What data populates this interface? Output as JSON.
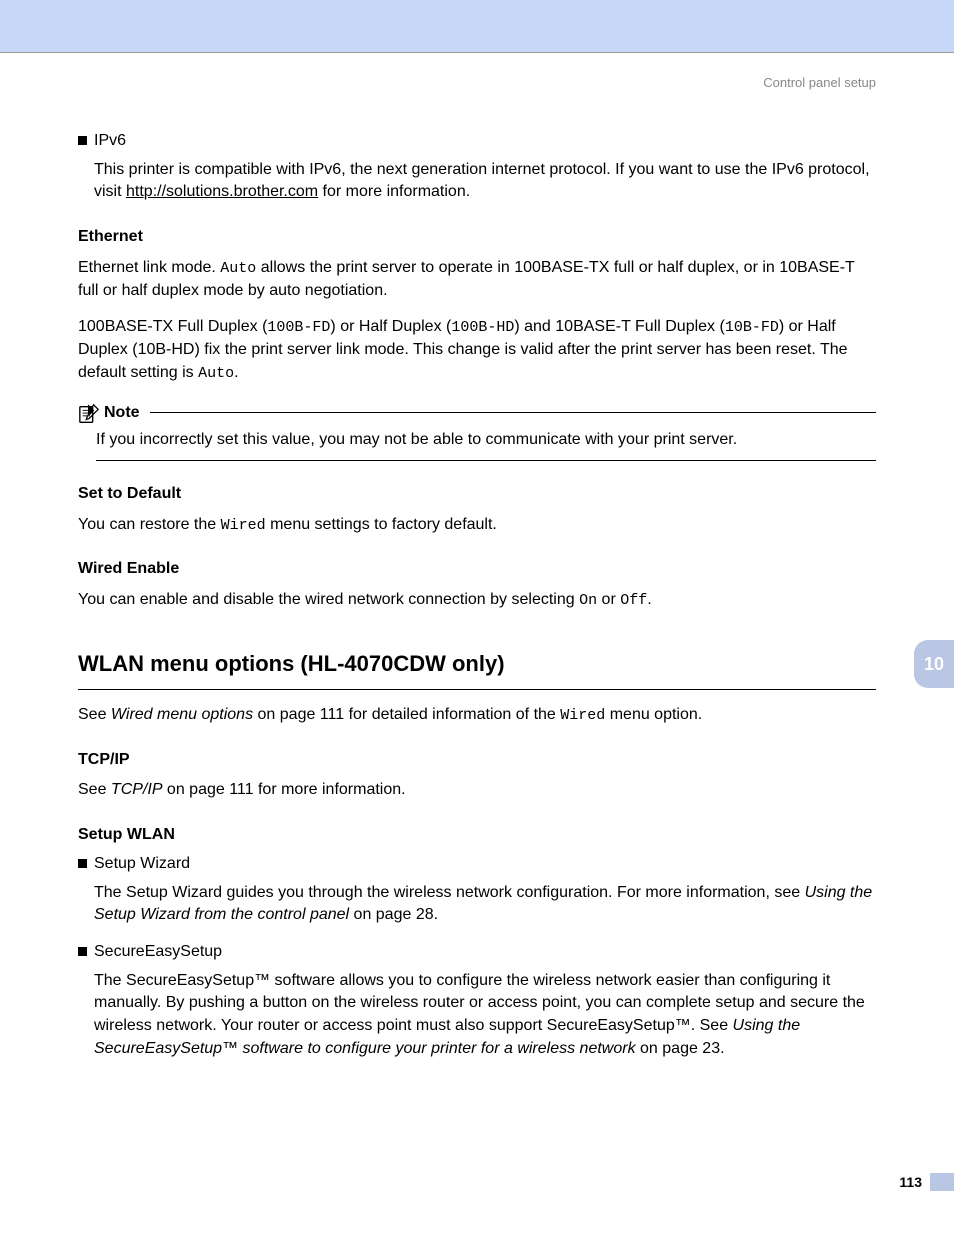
{
  "header": {
    "section_label": "Control panel setup"
  },
  "side_tab": {
    "chapter": "10"
  },
  "footer": {
    "page_number": "113"
  },
  "ipv6": {
    "bullet_label": "IPv6",
    "body_pre": "This printer is compatible with IPv6, the next generation internet protocol. If you want to use the IPv6 protocol, visit ",
    "link": "http://solutions.brother.com",
    "body_post": " for more information."
  },
  "ethernet": {
    "heading": "Ethernet",
    "p1_pre": "Ethernet link mode. ",
    "p1_auto": "Auto",
    "p1_post": " allows the print server to operate in 100BASE-TX full or half duplex, or in 10BASE-T full or half duplex mode by auto negotiation.",
    "p2_a": "100BASE-TX Full Duplex (",
    "p2_100fd": "100B-FD",
    "p2_b": ") or Half Duplex (",
    "p2_100hd": "100B-HD",
    "p2_c": ") and 10BASE-T Full Duplex (",
    "p2_10fd": "10B-FD",
    "p2_d": ") or Half Duplex (10B-HD) fix the print server link mode. This change is valid after the print server has been reset. The default setting is ",
    "p2_auto": "Auto",
    "p2_e": "."
  },
  "note": {
    "label": "Note",
    "body": "If you incorrectly set this value, you may not be able to communicate with your print server."
  },
  "set_default": {
    "heading": "Set to Default",
    "p_pre": "You can restore the ",
    "mono": "Wired",
    "p_post": " menu settings to factory default."
  },
  "wired_enable": {
    "heading": "Wired Enable",
    "p_pre": "You can enable and disable the wired network connection by selecting ",
    "on": "On",
    "mid": " or ",
    "off": "Off",
    "p_post": "."
  },
  "wlan": {
    "title": "WLAN menu options (HL-4070CDW only)",
    "intro_pre": "See ",
    "intro_em": "Wired menu options",
    "intro_mid": " on page 111 for detailed information of the ",
    "intro_mono": "Wired",
    "intro_post": " menu option.",
    "tcpip_heading": "TCP/IP",
    "tcpip_pre": "See ",
    "tcpip_em": "TCP/IP",
    "tcpip_post": " on page 111 for more information.",
    "setup_heading": "Setup WLAN",
    "wizard_label": "Setup Wizard",
    "wizard_body_pre": "The Setup Wizard guides you through the wireless network configuration. For more information, see ",
    "wizard_body_em": "Using the Setup Wizard from the control panel",
    "wizard_body_post": " on page 28.",
    "ses_label": "SecureEasySetup",
    "ses_body_pre": "The SecureEasySetup™ software allows you to configure the wireless network easier than configuring it manually. By pushing a button on the wireless router or access point, you can complete setup and secure the wireless network. Your router or access point must also support SecureEasySetup™. See ",
    "ses_body_em": "Using the SecureEasySetup™ software to configure your printer for a wireless network",
    "ses_body_post": " on page 23."
  }
}
